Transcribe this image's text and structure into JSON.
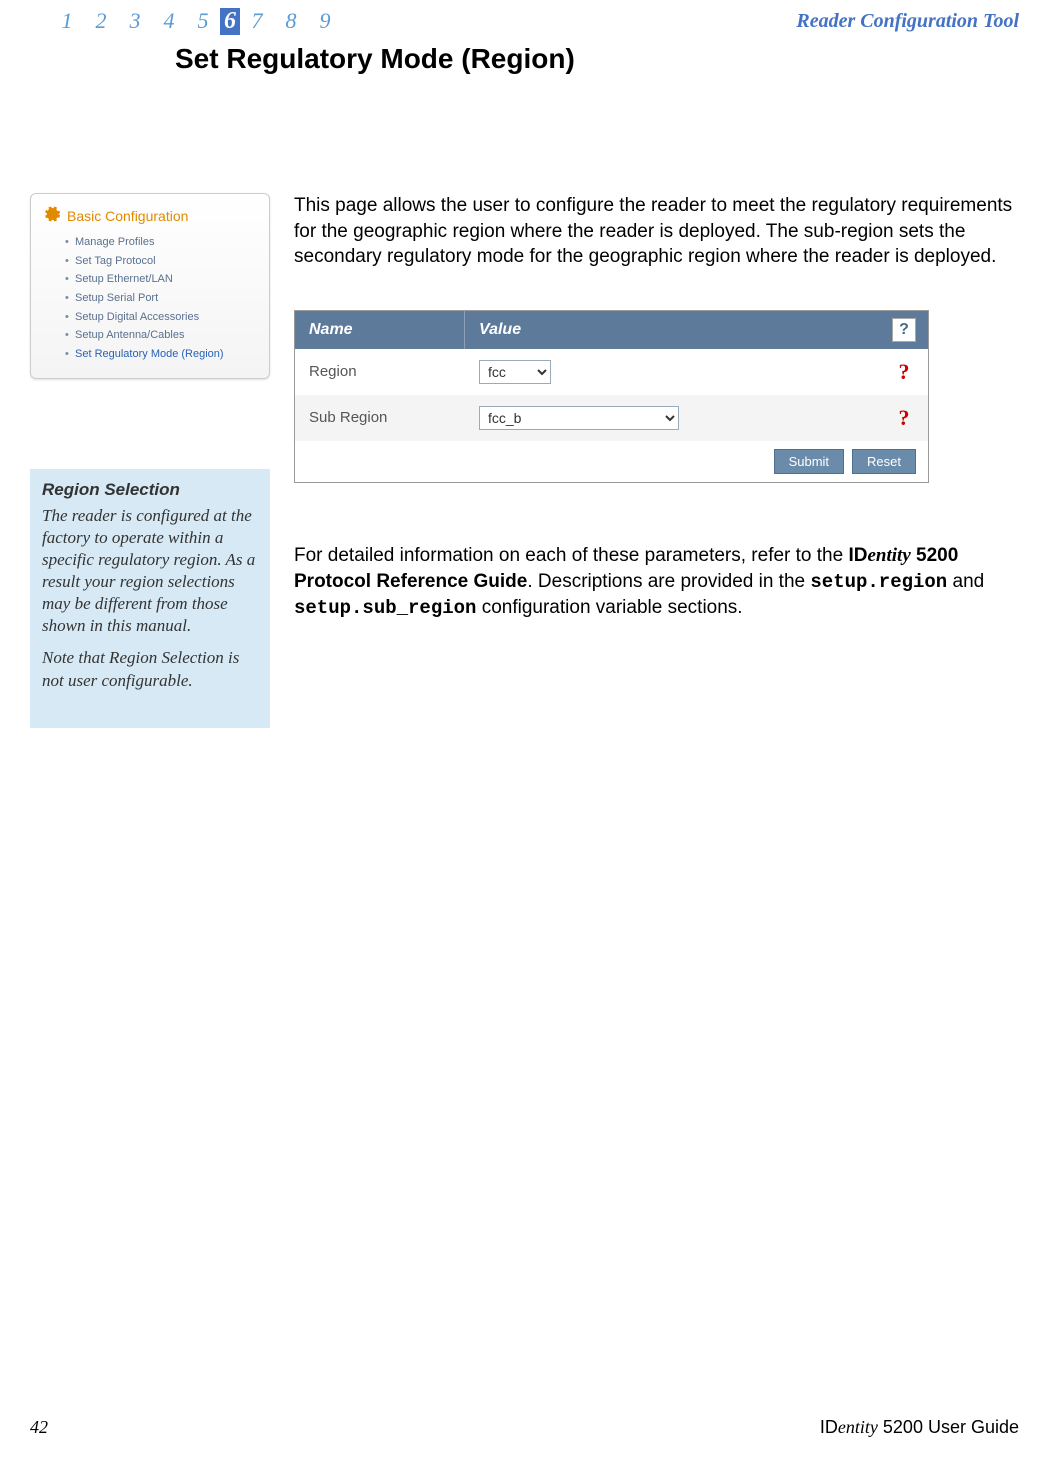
{
  "header": {
    "chapters": [
      "1",
      "2",
      "3",
      "4",
      "5",
      "6",
      "7",
      "8",
      "9"
    ],
    "active_chapter_index": 5,
    "tool_title": "Reader Configuration Tool"
  },
  "page": {
    "title": "Set Regulatory Mode (Region)",
    "intro": "This page allows the user to configure the reader to meet the regulatory requirements for the geographic region where the reader is deployed. The sub-region sets the secondary regulatory mode for the geographic region where the reader is deployed."
  },
  "nav_panel": {
    "title": "Basic Configuration",
    "items": [
      "Manage Profiles",
      "Set Tag Protocol",
      "Setup Ethernet/LAN",
      "Setup Serial Port",
      "Setup Digital Accessories",
      "Setup Antenna/Cables",
      "Set Regulatory Mode (Region)"
    ],
    "active_index": 6
  },
  "sidebar_note": {
    "heading": "Region Selection",
    "p1": "The reader is configured at the factory to operate within a specific regulatory region. As a result your region selections may be different from those shown in this manual.",
    "p2": "Note that Region Selection is not user configurable."
  },
  "form": {
    "header_name": "Name",
    "header_value": "Value",
    "help_label": "?",
    "rows": [
      {
        "name": "Region",
        "value": "fcc"
      },
      {
        "name": "Sub Region",
        "value": "fcc_b"
      }
    ],
    "row_help": "?",
    "submit_label": "Submit",
    "reset_label": "Reset"
  },
  "detail": {
    "pre": "For detailed information on each of these parameters, refer to the ",
    "guide_id": "ID",
    "guide_entity": "entity",
    "guide_rest": " 5200 Protocol Reference Guide",
    "mid1": ".  Descriptions are provided in the ",
    "code1": "setup.region",
    "and": " and ",
    "code2": "setup.sub_region",
    "post": " configuration variable sections."
  },
  "footer": {
    "page_number": "42",
    "guide_id": "ID",
    "guide_entity": "entity",
    "guide_rest": " 5200 User Guide"
  }
}
